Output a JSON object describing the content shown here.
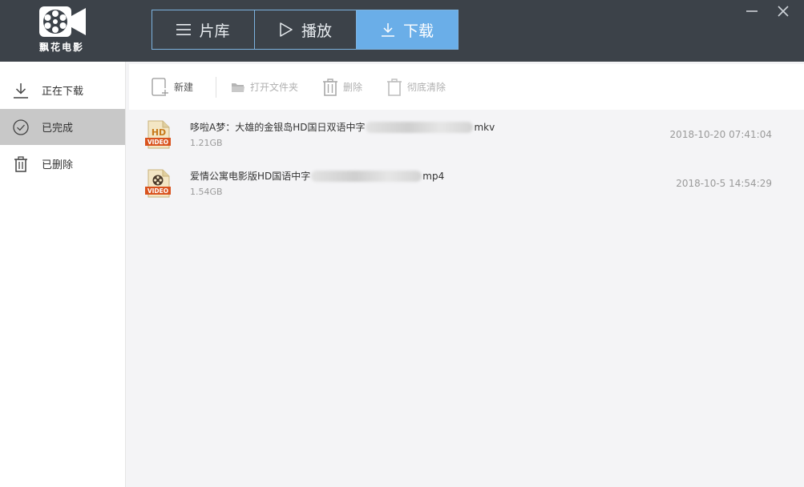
{
  "app": {
    "name": "飘花电影"
  },
  "nav": {
    "tabs": [
      {
        "label": "片库",
        "icon": "menu-icon"
      },
      {
        "label": "播放",
        "icon": "play-icon"
      },
      {
        "label": "下载",
        "icon": "download-icon"
      }
    ],
    "active": "下载"
  },
  "window": {
    "minimize_icon": "minimize-icon",
    "close_icon": "close-icon"
  },
  "sidebar": {
    "items": [
      {
        "label": "正在下载",
        "icon": "download-icon"
      },
      {
        "label": "已完成",
        "icon": "check-circle-icon"
      },
      {
        "label": "已删除",
        "icon": "trash-icon"
      }
    ],
    "active": "已完成"
  },
  "toolbar": {
    "new_label": "新建",
    "open_folder_label": "打开文件夹",
    "delete_label": "删除",
    "purge_label": "彻底清除"
  },
  "files": [
    {
      "name_prefix": "哆啦A梦：大雄的金银岛HD国日双语中字",
      "name_suffix": "mkv",
      "size": "1.21GB",
      "date": "2018-10-20 07:41:04",
      "icon": "hd-video-icon"
    },
    {
      "name_prefix": "爱情公寓电影版HD国语中字",
      "name_suffix": "mp4",
      "size": "1.54GB",
      "date": "2018-10-5 14:54:29",
      "icon": "video-file-icon"
    }
  ],
  "colors": {
    "topbar": "#3c4249",
    "accent": "#6aaee8",
    "sidebar_active": "#c8c8c8"
  }
}
